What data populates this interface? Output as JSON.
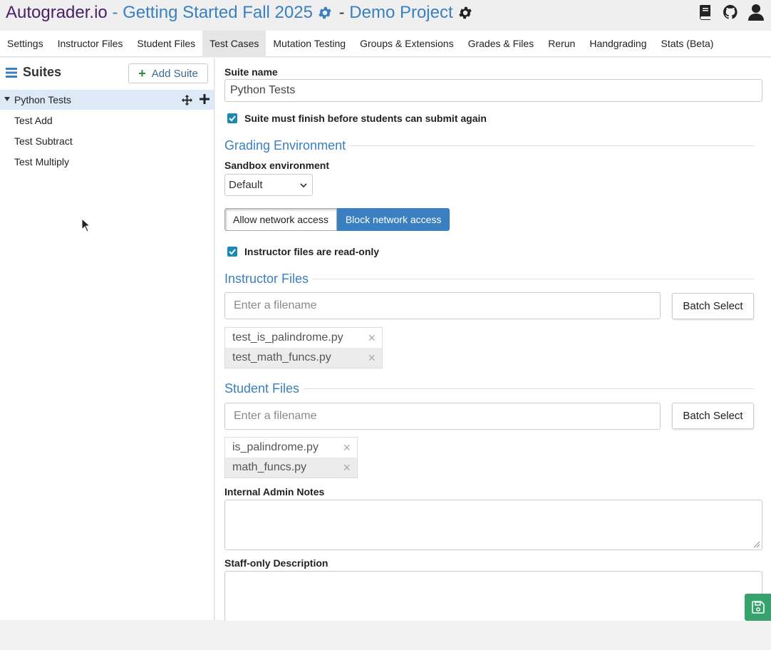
{
  "header": {
    "brand": "Autograder.io",
    "sep1": " - ",
    "course": "Getting Started Fall 2025",
    "sep2": " - ",
    "project": "Demo Project",
    "icons": [
      "gear-icon",
      "book-icon",
      "github-icon",
      "user-icon"
    ]
  },
  "tabs": [
    {
      "label": "Settings"
    },
    {
      "label": "Instructor Files"
    },
    {
      "label": "Student Files"
    },
    {
      "label": "Test Cases",
      "active": true
    },
    {
      "label": "Mutation Testing"
    },
    {
      "label": "Groups & Extensions"
    },
    {
      "label": "Grades & Files"
    },
    {
      "label": "Rerun"
    },
    {
      "label": "Handgrading"
    },
    {
      "label": "Stats (Beta)"
    }
  ],
  "sidebar": {
    "title": "Suites",
    "add_suite_label": "Add Suite",
    "suite": {
      "name": "Python Tests",
      "cases": [
        "Test Add",
        "Test Subtract",
        "Test Multiply"
      ]
    }
  },
  "main": {
    "suite_name_label": "Suite name",
    "suite_name_value": "Python Tests",
    "must_finish_label": "Suite must finish before students can submit again",
    "must_finish_checked": true,
    "grading_env_title": "Grading Environment",
    "sandbox_label": "Sandbox environment",
    "sandbox_value": "Default",
    "allow_network_label": "Allow network access",
    "block_network_label": "Block network access",
    "network_selected": "block",
    "readonly_label": "Instructor files are read-only",
    "readonly_checked": true,
    "instructor_files": {
      "title": "Instructor Files",
      "placeholder": "Enter a filename",
      "batch_label": "Batch Select",
      "files": [
        "test_is_palindrome.py",
        "test_math_funcs.py"
      ]
    },
    "student_files": {
      "title": "Student Files",
      "placeholder": "Enter a filename",
      "batch_label": "Batch Select",
      "files": [
        "is_palindrome.py",
        "math_funcs.py"
      ]
    },
    "admin_notes_label": "Internal Admin Notes",
    "staff_desc_label": "Staff-only Description"
  },
  "colors": {
    "brand": "#4a2169",
    "link": "#3a80c0",
    "save": "#36a36c",
    "checkbox": "#1a8ab4"
  }
}
